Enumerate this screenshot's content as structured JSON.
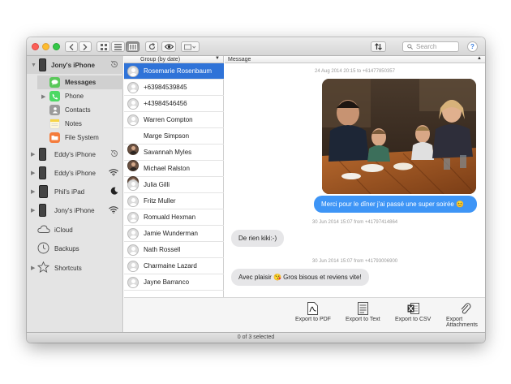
{
  "toolbar": {
    "search_placeholder": "Search",
    "help_label": "?"
  },
  "columns": {
    "group_label": "Group (by date)",
    "message_label": "Message"
  },
  "sidebar": {
    "device": {
      "name": "Jony's iPhone",
      "apps": [
        {
          "label": "Messages",
          "icon": "messages-icon",
          "color": "#5ac85a"
        },
        {
          "label": "Phone",
          "icon": "phone-icon",
          "color": "#4cd964"
        },
        {
          "label": "Contacts",
          "icon": "contacts-icon",
          "color": "#8e8e8e"
        },
        {
          "label": "Notes",
          "icon": "notes-icon",
          "color": "#f7d443"
        },
        {
          "label": "File System",
          "icon": "file-system-icon",
          "color": "#f47c3c"
        }
      ]
    },
    "devices": [
      {
        "label": "Eddy's iPhone",
        "status_icon": "history-icon"
      },
      {
        "label": "Eddy's iPhone",
        "status_icon": "wifi-icon"
      },
      {
        "label": "Phil's iPad",
        "status_icon": "moon-icon"
      },
      {
        "label": "Jony's iPhone",
        "status_icon": "wifi-icon"
      }
    ],
    "icloud": "iCloud",
    "backups": "Backups",
    "shortcuts": "Shortcuts"
  },
  "contacts": [
    {
      "name": "Rosemarie Rosenbaum",
      "selected": true
    },
    {
      "name": "+63984539845"
    },
    {
      "name": "+43984546456"
    },
    {
      "name": "Warren Compton"
    },
    {
      "name": "Marge Simpson"
    },
    {
      "name": "Savannah Myles"
    },
    {
      "name": "Michael Ralston"
    },
    {
      "name": "Julia Gilli"
    },
    {
      "name": "Fritz Muller"
    },
    {
      "name": "Romuald Hexman"
    },
    {
      "name": "Jamie Wunderman"
    },
    {
      "name": "Nath Rossell"
    },
    {
      "name": "Charmaine Lazard"
    },
    {
      "name": "Jayne Barranco"
    }
  ],
  "messages": {
    "ts1": "24 Aug 2014 20:15 to +61477850357",
    "msg1": "Merci pour le dîner j'ai passé une super soirée 😊",
    "ts2": "30 Jun 2014 15:07 from +41797414864",
    "msg2": "De rien kiki:-)",
    "ts3": "30 Jun 2014 15:07 from +41793006900",
    "msg3": "Avec plaisir 😘 Gros bisous et reviens vite!"
  },
  "export": {
    "pdf": "Export to PDF",
    "text": "Export to Text",
    "csv": "Export to CSV",
    "attachments": "Export Attachments"
  },
  "status": "0 of 3 selected",
  "colors": {
    "selection": "#2f73d8",
    "outgoing_bubble": "#3e95f6",
    "incoming_bubble": "#e6e6e8"
  }
}
